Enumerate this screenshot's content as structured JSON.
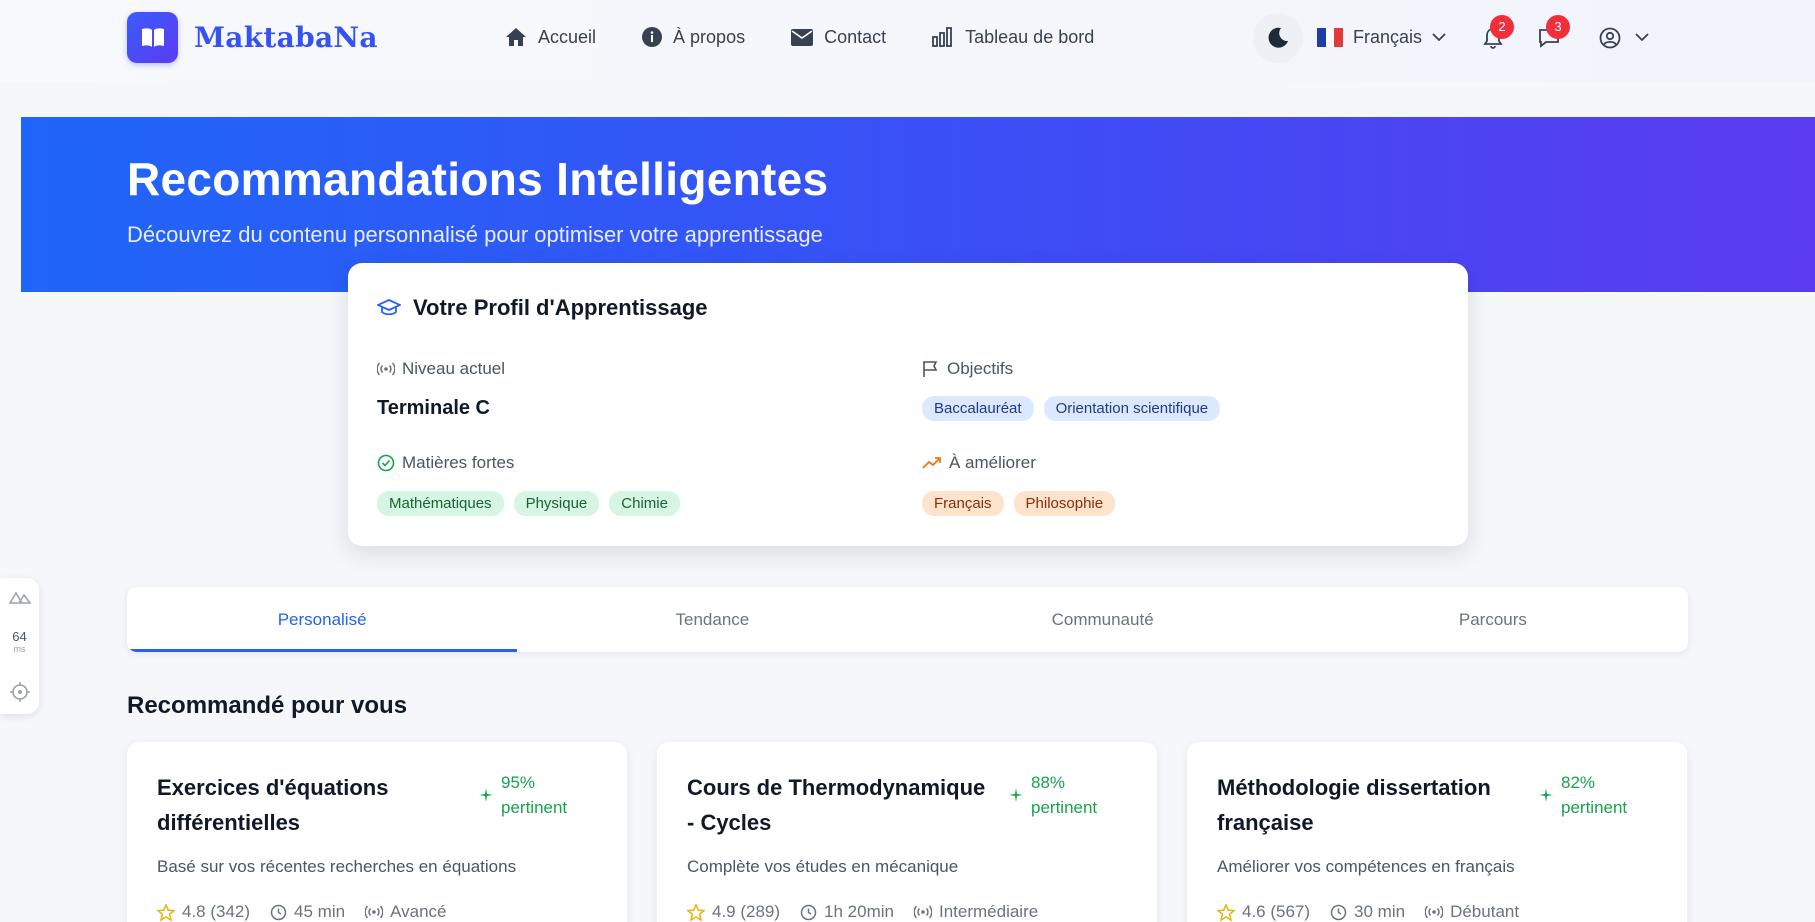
{
  "brand": {
    "name": "MaktabaNa"
  },
  "nav": [
    {
      "label": "Accueil",
      "icon": "home-icon"
    },
    {
      "label": "À propos",
      "icon": "info-icon"
    },
    {
      "label": "Contact",
      "icon": "mail-icon"
    },
    {
      "label": "Tableau de bord",
      "icon": "bar-chart-icon"
    }
  ],
  "toolbar": {
    "language": "Français",
    "notifications_count": "2",
    "messages_count": "3"
  },
  "hero": {
    "title": "Recommandations Intelligentes",
    "subtitle": "Découvrez du contenu personnalisé pour optimiser votre apprentissage"
  },
  "profile": {
    "title": "Votre Profil d'Apprentissage",
    "level_label": "Niveau actuel",
    "level_value": "Terminale C",
    "goals_label": "Objectifs",
    "goals": [
      "Baccalauréat",
      "Orientation scientifique"
    ],
    "strengths_label": "Matières fortes",
    "strengths": [
      "Mathématiques",
      "Physique",
      "Chimie"
    ],
    "improve_label": "À améliorer",
    "improve": [
      "Français",
      "Philosophie"
    ]
  },
  "tabs": [
    "Personalisé",
    "Tendance",
    "Communauté",
    "Parcours"
  ],
  "section_title": "Recommandé pour vous",
  "cards": [
    {
      "title": "Exercices d'équations différentielles",
      "score_pct": "95%",
      "score_label": "pertinent",
      "description": "Basé sur vos récentes recherches en équations",
      "rating": "4.8 (342)",
      "duration": "45 min",
      "level": "Avancé"
    },
    {
      "title": "Cours de Thermodynamique - Cycles",
      "score_pct": "88%",
      "score_label": "pertinent",
      "description": "Complète vos études en mécanique",
      "rating": "4.9 (289)",
      "duration": "1h 20min",
      "level": "Intermédiaire"
    },
    {
      "title": "Méthodologie dissertation française",
      "score_pct": "82%",
      "score_label": "pertinent",
      "description": "Améliorer vos compétences en français",
      "rating": "4.6 (567)",
      "duration": "30 min",
      "level": "Débutant"
    }
  ],
  "devtools": {
    "latency_value": "64",
    "latency_unit": "ms"
  },
  "colors": {
    "primary": "#2563eb",
    "hero_start": "#1f66f8",
    "hero_end": "#5b3bf0",
    "score": "#16a34a"
  }
}
